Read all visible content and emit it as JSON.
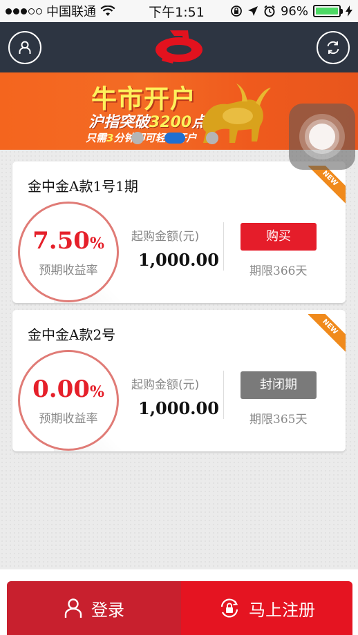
{
  "statusbar": {
    "carrier": "中国联通",
    "time": "下午1:51",
    "battery": "96%"
  },
  "header": {
    "left_icon": "user-icon",
    "right_icon": "refresh-icon",
    "logo_icon": "brand-logo"
  },
  "banner": {
    "title": "牛市开户",
    "subtitle_pre": "沪指突破",
    "subtitle_num": "3200",
    "subtitle_post": "点",
    "small_pre": "只需",
    "small_num": "3",
    "small_post": "分钟即可轻松开户",
    "page_count": 3,
    "active_page": 2
  },
  "products": [
    {
      "title": "金中金A款1号1期",
      "badge": "NEW",
      "rate": "7.50",
      "rate_unit": "%",
      "rate_label": "预期收益率",
      "amount_label": "起购金额(元)",
      "amount": "1,000.00",
      "button": "购买",
      "term_label": "期限",
      "term_value": "366",
      "term_unit": "天"
    },
    {
      "title": "金中金A款2号",
      "badge": "NEW",
      "rate": "0.00",
      "rate_unit": "%",
      "rate_label": "预期收益率",
      "amount_label": "起购金额(元)",
      "amount": "1,000.00",
      "button": "封闭期",
      "term_label": "期限",
      "term_value": "365",
      "term_unit": "天"
    }
  ],
  "bottom": {
    "login_label": "登录",
    "register_label": "马上注册"
  },
  "colors": {
    "header_bg": "#2d3542",
    "accent_red": "#e51d2a",
    "banner_orange": "#f36b25",
    "closed_gray": "#7a7a7a"
  }
}
